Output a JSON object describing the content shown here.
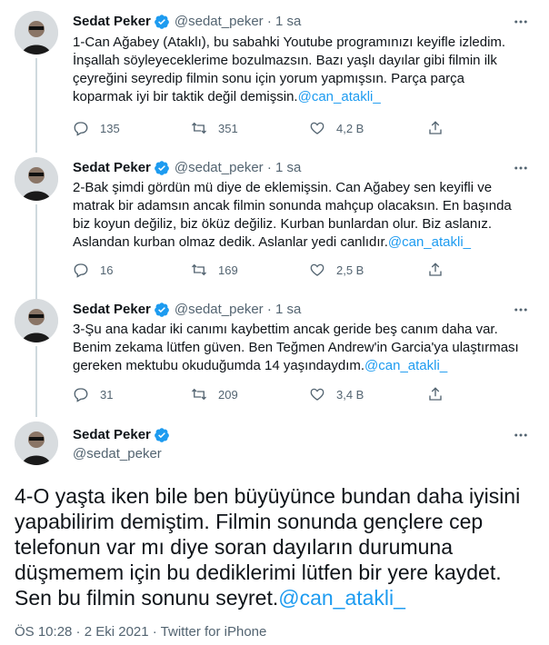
{
  "author": {
    "name": "Sedat Peker",
    "handle": "@sedat_peker",
    "verified": true
  },
  "thread": [
    {
      "time": "1 sa",
      "text": "1-Can Ağabey (Ataklı), bu sabahki Youtube programınızı keyifle izledim. İnşallah söyleyeceklerime bozulmazsın. Bazı yaşlı dayılar gibi filmin ilk çeyreğini seyredip filmin sonu için yorum yapmışsın. Parça parça koparmak iyi bir taktik değil demişsin.",
      "mention": "@can_atakli_",
      "replies": "135",
      "retweets": "351",
      "likes": "4,2 B"
    },
    {
      "time": "1 sa",
      "text": "2-Bak şimdi gördün mü diye de eklemişsin. Can Ağabey sen keyifli ve matrak bir adamsın ancak filmin sonunda mahçup olacaksın. En başında biz koyun değiliz, biz öküz değiliz. Kurban bunlardan olur. Biz aslanız. Aslandan kurban olmaz dedik. Aslanlar yedi canlıdır.",
      "mention": "@can_atakli_",
      "replies": "16",
      "retweets": "169",
      "likes": "2,5 B"
    },
    {
      "time": "1 sa",
      "text": "3-Şu ana kadar iki canımı kaybettim ancak geride beş canım daha var. Benim zekama lütfen güven. Ben Teğmen Andrew'in Garcia'ya ulaştırması gereken mektubu okuduğumda 14 yaşındaydım.",
      "mention": "@can_atakli_",
      "replies": "31",
      "retweets": "209",
      "likes": "3,4 B"
    }
  ],
  "main_tweet": {
    "text": "4-O yaşta iken bile ben büyüyünce bundan daha iyisini yapabilirim demiştim. Filmin sonunda gençlere cep telefonun var mı diye soran dayıların durumuna düşmemem için bu dediklerimi lütfen bir yere kaydet. Sen bu filmin sonunu seyret.",
    "mention": "@can_atakli_",
    "timestamp": "ÖS 10:28 · 2 Eki 2021 · Twitter for iPhone"
  },
  "colors": {
    "link": "#1d9bf0",
    "verified": "#1d9bf0",
    "muted": "#536471",
    "divider": "#eff3f4"
  }
}
